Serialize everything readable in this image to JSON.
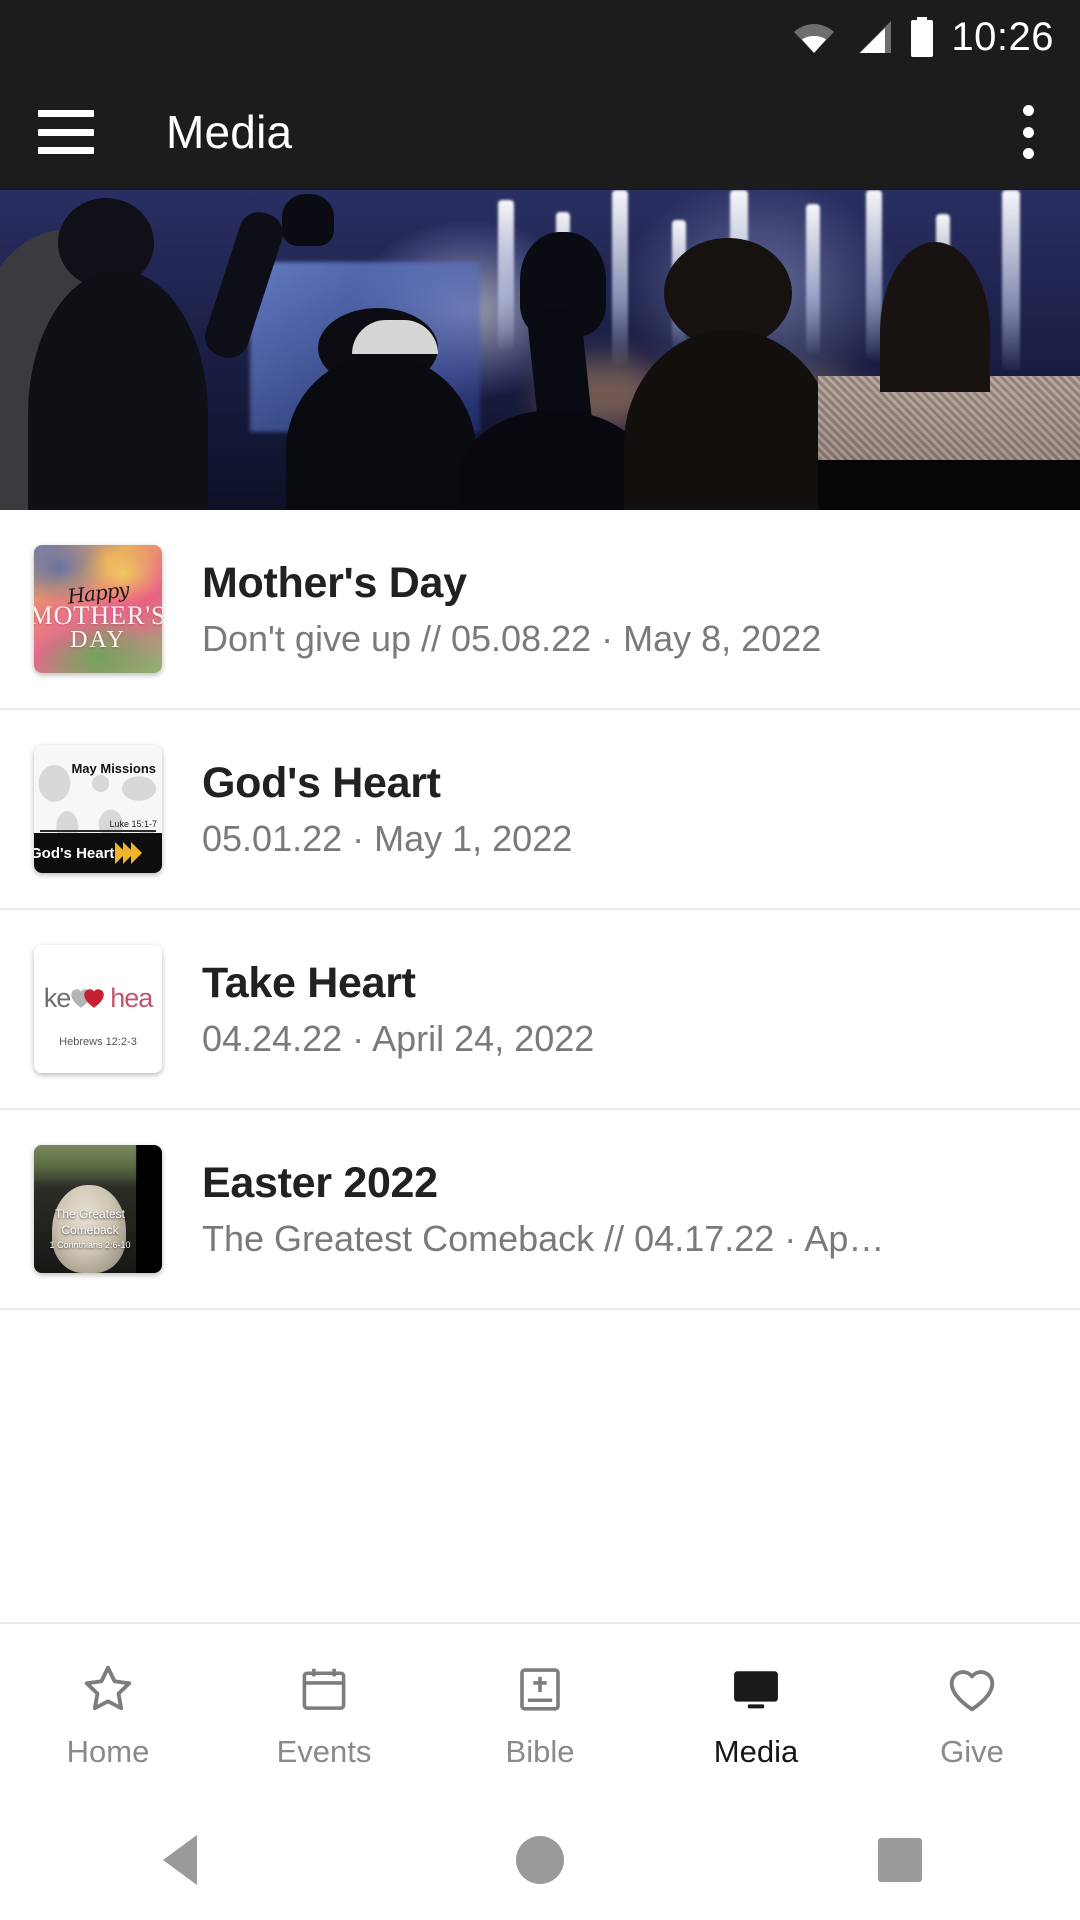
{
  "status_bar": {
    "time": "10:26",
    "icons": [
      "wifi-icon",
      "cellular-signal-icon",
      "battery-icon"
    ]
  },
  "app_bar": {
    "menu_icon": "hamburger-menu-icon",
    "title": "Media",
    "overflow_icon": "more-vertical-icon"
  },
  "hero": {
    "alt": "worship-congregation-photo"
  },
  "media_list": [
    {
      "title": "Mother's Day",
      "subtitle": "Don't give up // 05.08.22 · May 8, 2022",
      "thumbnail": {
        "name": "mothers-day-thumbnail",
        "script": "Happy",
        "line1": "MOTHER'S",
        "line2": "DAY"
      }
    },
    {
      "title": "God's Heart",
      "subtitle": "05.01.22 · May 1, 2022",
      "thumbnail": {
        "name": "gods-heart-thumbnail",
        "top_label": "May Missions",
        "bar_label": "God's Heart",
        "reference": "Luke 15:1-7"
      }
    },
    {
      "title": "Take Heart",
      "subtitle": "04.24.22 · April 24, 2022",
      "thumbnail": {
        "name": "take-heart-thumbnail",
        "left_text": "ke",
        "right_text": "hea",
        "reference": "Hebrews 12:2-3"
      }
    },
    {
      "title": "Easter 2022",
      "subtitle": "The Greatest Comeback // 04.17.22 · Ap…",
      "thumbnail": {
        "name": "easter-2022-thumbnail",
        "line1": "The Greatest",
        "line2": "Comeback",
        "reference": "1 Corinthians 2:6-10"
      }
    }
  ],
  "bottom_nav": {
    "active": "Media",
    "items": [
      {
        "label": "Home",
        "icon": "star-icon"
      },
      {
        "label": "Events",
        "icon": "calendar-icon"
      },
      {
        "label": "Bible",
        "icon": "bible-book-icon"
      },
      {
        "label": "Media",
        "icon": "monitor-icon"
      },
      {
        "label": "Give",
        "icon": "heart-icon"
      }
    ]
  },
  "android_nav": {
    "back": "back-triangle-icon",
    "home": "home-circle-icon",
    "recents": "recents-square-icon"
  },
  "colors": {
    "app_bar_bg": "#1c1c1c",
    "page_bg": "#ffffff",
    "title_text": "#212121",
    "subtitle_text": "#7a7a7a",
    "nav_inactive": "#8a8a8a",
    "nav_active": "#161616",
    "divider": "#ececec"
  }
}
